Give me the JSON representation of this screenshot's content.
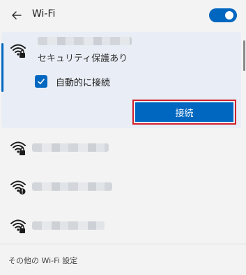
{
  "header": {
    "title": "Wi-Fi"
  },
  "selected_network": {
    "security": "セキュリティ保護あり",
    "auto_connect_label": "自動的に接続",
    "auto_connect_checked": true,
    "connect_label": "接続"
  },
  "networks": [
    {
      "icon": "wifi-lock-icon"
    },
    {
      "icon": "wifi-lock-icon"
    },
    {
      "icon": "wifi-warning-icon"
    },
    {
      "icon": "wifi-lock-icon"
    }
  ],
  "footer": {
    "more_settings": "その他の Wi-Fi 設定"
  },
  "colors": {
    "accent": "#0067c0",
    "highlight_border": "#d1202d",
    "background": "#f3f3f3"
  }
}
